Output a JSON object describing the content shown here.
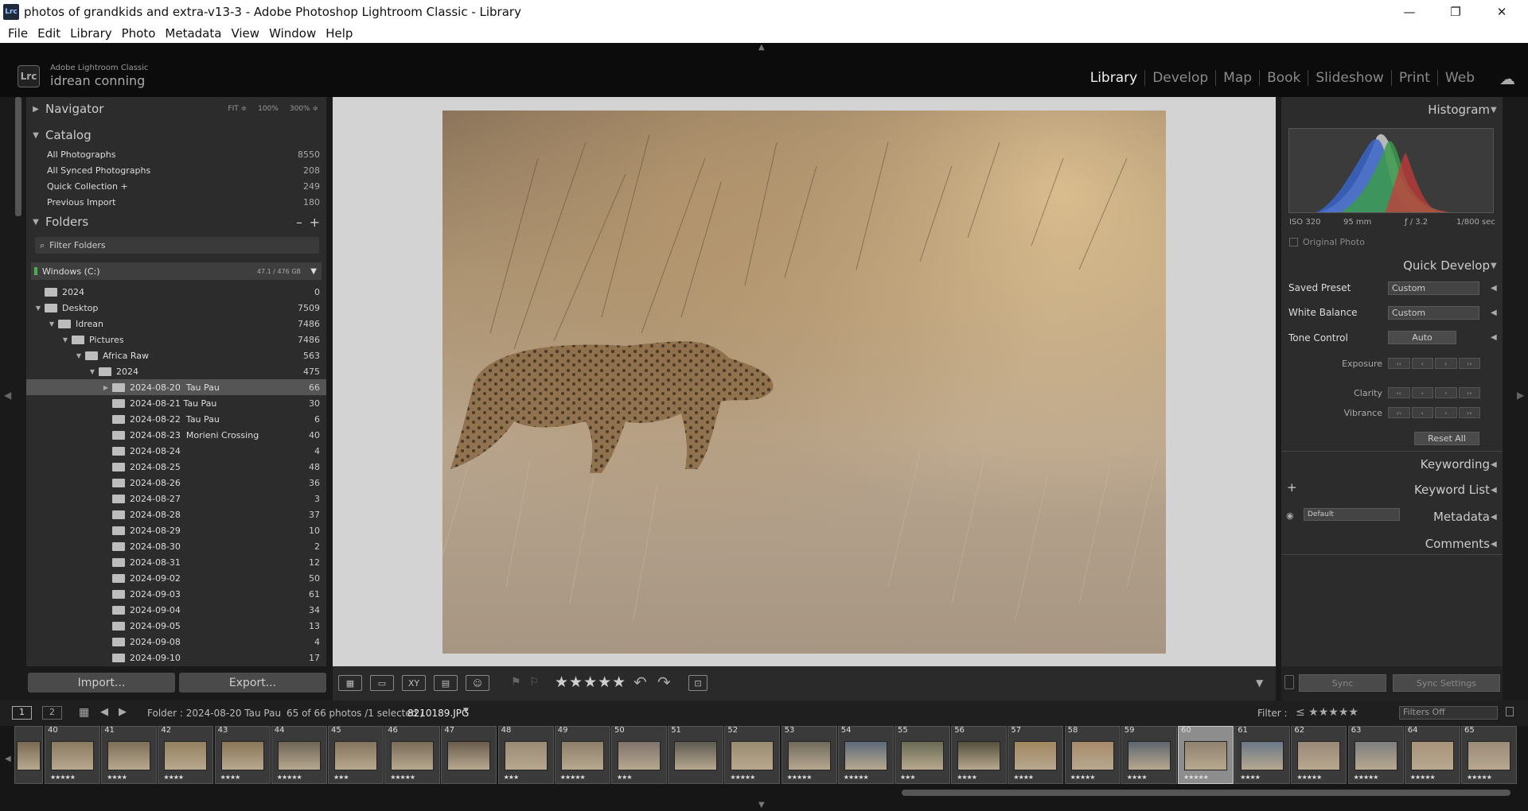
{
  "titlebar": {
    "app_icon": "Lrc",
    "title": "photos of grandkids and extra-v13-3 - Adobe Photoshop Lightroom Classic - Library",
    "min": "—",
    "max": "❐",
    "close": "✕"
  },
  "menu": [
    "File",
    "Edit",
    "Library",
    "Photo",
    "Metadata",
    "View",
    "Window",
    "Help"
  ],
  "identity": {
    "badge": "Lrc",
    "small": "Adobe Lightroom Classic",
    "name": "idrean conning"
  },
  "modules": [
    "Library",
    "Develop",
    "Map",
    "Book",
    "Slideshow",
    "Print",
    "Web"
  ],
  "navigator": {
    "title": "Navigator",
    "fit": "FIT ≑",
    "z100": "100%",
    "z300": "300% ≑"
  },
  "catalog": {
    "title": "Catalog",
    "rows": [
      {
        "label": "All Photographs",
        "count": "8550"
      },
      {
        "label": "All Synced Photographs",
        "count": "208"
      },
      {
        "label": "Quick Collection +",
        "count": "249"
      },
      {
        "label": "Previous Import",
        "count": "180"
      }
    ]
  },
  "folders": {
    "title": "Folders",
    "minus": "–",
    "plus": "+",
    "filter_placeholder": "Filter Folders",
    "drive": {
      "label": "Windows (C:)",
      "space": "47.1 / 476 GB"
    },
    "rows": [
      {
        "name": "2024",
        "count": "0",
        "tri": "",
        "indent": 0
      },
      {
        "name": "Desktop",
        "count": "7509",
        "tri": "▼",
        "indent": 0
      },
      {
        "name": "Idrean",
        "count": "7486",
        "tri": "▼",
        "indent": 1
      },
      {
        "name": "Pictures",
        "count": "7486",
        "tri": "▼",
        "indent": 2
      },
      {
        "name": "Africa Raw",
        "count": "563",
        "tri": "▼",
        "indent": 3
      },
      {
        "name": "2024",
        "count": "475",
        "tri": "▼",
        "indent": 4
      },
      {
        "name": "2024-08-20  Tau Pau",
        "count": "66",
        "tri": "▶",
        "indent": 5
      },
      {
        "name": "2024-08-21 Tau Pau",
        "count": "30",
        "tri": "",
        "indent": 5
      },
      {
        "name": "2024-08-22  Tau Pau",
        "count": "6",
        "tri": "",
        "indent": 5
      },
      {
        "name": "2024-08-23  Morieni Crossing",
        "count": "40",
        "tri": "",
        "indent": 5
      },
      {
        "name": "2024-08-24",
        "count": "4",
        "tri": "",
        "indent": 5
      },
      {
        "name": "2024-08-25",
        "count": "48",
        "tri": "",
        "indent": 5
      },
      {
        "name": "2024-08-26",
        "count": "36",
        "tri": "",
        "indent": 5
      },
      {
        "name": "2024-08-27",
        "count": "3",
        "tri": "",
        "indent": 5
      },
      {
        "name": "2024-08-28",
        "count": "37",
        "tri": "",
        "indent": 5
      },
      {
        "name": "2024-08-29",
        "count": "10",
        "tri": "",
        "indent": 5
      },
      {
        "name": "2024-08-30",
        "count": "2",
        "tri": "",
        "indent": 5
      },
      {
        "name": "2024-08-31",
        "count": "12",
        "tri": "",
        "indent": 5
      },
      {
        "name": "2024-09-02",
        "count": "50",
        "tri": "",
        "indent": 5
      },
      {
        "name": "2024-09-03",
        "count": "61",
        "tri": "",
        "indent": 5
      },
      {
        "name": "2024-09-04",
        "count": "34",
        "tri": "",
        "indent": 5
      },
      {
        "name": "2024-09-05",
        "count": "13",
        "tri": "",
        "indent": 5
      },
      {
        "name": "2024-09-08",
        "count": "4",
        "tri": "",
        "indent": 5
      },
      {
        "name": "2024-09-10",
        "count": "17",
        "tri": "",
        "indent": 5
      }
    ],
    "selected_index": 6
  },
  "buttons": {
    "import": "Import...",
    "export": "Export..."
  },
  "toolbar": {
    "stars": "★★★★★"
  },
  "histogram": {
    "title": "Histogram",
    "iso": "ISO 320",
    "focal": "95 mm",
    "aperture": "ƒ / 3.2",
    "shutter": "1/800 sec",
    "original": "Original Photo"
  },
  "quick_develop": {
    "title": "Quick Develop",
    "saved_preset_label": "Saved Preset",
    "saved_preset_value": "Custom",
    "wb_label": "White Balance",
    "wb_value": "Custom",
    "tone_label": "Tone Control",
    "tone_auto": "Auto",
    "exposure": "Exposure",
    "clarity": "Clarity",
    "vibrance": "Vibrance",
    "reset": "Reset All"
  },
  "right_sections": {
    "keywording": "Keywording",
    "keyword_list": "Keyword List",
    "metadata": "Metadata",
    "metadata_preset": "Default",
    "comments": "Comments"
  },
  "sync": {
    "sync": "Sync",
    "sync_settings": "Sync Settings"
  },
  "filmbar": {
    "screen1": "1",
    "screen2": "2",
    "folder": "Folder : 2024-08-20  Tau Pau",
    "count": "65 of 66 photos /1 selected /",
    "file": "8210189.JPG",
    "filter_label": "Filter :",
    "filter_value": "Filters Off"
  },
  "film": [
    {
      "n": "",
      "r": "",
      "c": "#7a6a55"
    },
    {
      "n": "40",
      "r": "★★★★★",
      "c": "#8a7a60"
    },
    {
      "n": "41",
      "r": "★★★★",
      "c": "#7d6e58"
    },
    {
      "n": "42",
      "r": "★★★★",
      "c": "#94805f"
    },
    {
      "n": "43",
      "r": "★★★★",
      "c": "#8a7658"
    },
    {
      "n": "44",
      "r": "★★★★★",
      "c": "#6f6556"
    },
    {
      "n": "45",
      "r": "★★★",
      "c": "#85745d"
    },
    {
      "n": "46",
      "r": "★★★★★",
      "c": "#7a6b58"
    },
    {
      "n": "47",
      "r": "",
      "c": "#6a5d4e"
    },
    {
      "n": "48",
      "r": "★★★",
      "c": "#9a8a74"
    },
    {
      "n": "49",
      "r": "★★★★★",
      "c": "#8c7e6a"
    },
    {
      "n": "50",
      "r": "★★★",
      "c": "#80736a"
    },
    {
      "n": "51",
      "r": "",
      "c": "#5e5a52"
    },
    {
      "n": "52",
      "r": "★★★★★",
      "c": "#9a8c70"
    },
    {
      "n": "53",
      "r": "★★★★★",
      "c": "#706a5e"
    },
    {
      "n": "54",
      "r": "★★★★★",
      "c": "#5d6a7a"
    },
    {
      "n": "55",
      "r": "★★★",
      "c": "#6a6a55"
    },
    {
      "n": "56",
      "r": "★★★★",
      "c": "#55503d"
    },
    {
      "n": "57",
      "r": "★★★★",
      "c": "#a08660"
    },
    {
      "n": "58",
      "r": "★★★★★",
      "c": "#a88a6a"
    },
    {
      "n": "59",
      "r": "★★★★",
      "c": "#5e6670"
    },
    {
      "n": "60",
      "r": "★★★★★",
      "c": "#908270"
    },
    {
      "n": "61",
      "r": "★★★★",
      "c": "#6a7888"
    },
    {
      "n": "62",
      "r": "★★★★★",
      "c": "#9a8878"
    },
    {
      "n": "63",
      "r": "★★★★★",
      "c": "#7d7e80"
    },
    {
      "n": "64",
      "r": "★★★★★",
      "c": "#a8947a"
    },
    {
      "n": "65",
      "r": "★★★★★",
      "c": "#9a8a78"
    }
  ],
  "film_selected": 21
}
